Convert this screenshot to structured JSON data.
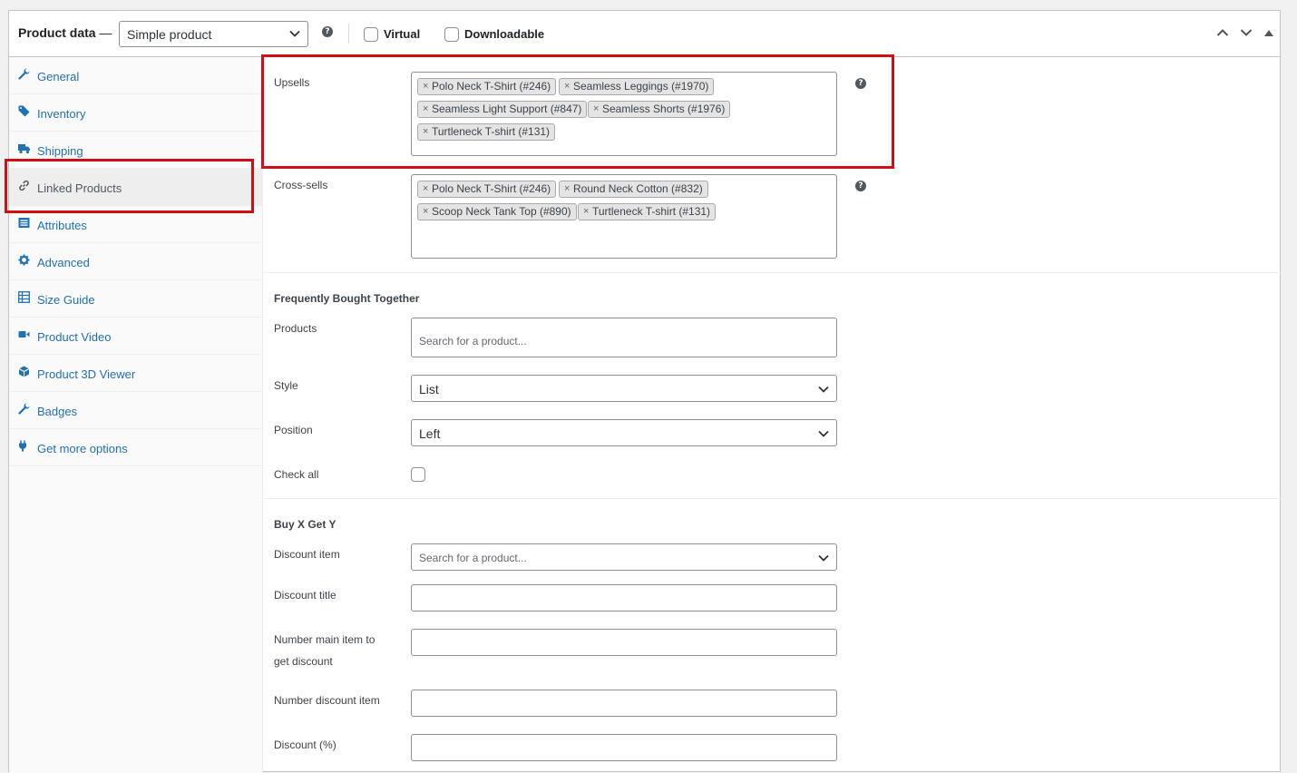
{
  "header": {
    "title": "Product data",
    "dash": "—",
    "product_type": "Simple product",
    "virtual_label": "Virtual",
    "downloadable_label": "Downloadable"
  },
  "sidebar": {
    "items": [
      {
        "label": "General",
        "icon": "wrench-icon"
      },
      {
        "label": "Inventory",
        "icon": "tag-icon"
      },
      {
        "label": "Shipping",
        "icon": "truck-icon"
      },
      {
        "label": "Linked Products",
        "icon": "link-icon",
        "active": true
      },
      {
        "label": "Attributes",
        "icon": "list-icon"
      },
      {
        "label": "Advanced",
        "icon": "gear-icon"
      },
      {
        "label": "Size Guide",
        "icon": "table-icon"
      },
      {
        "label": "Product Video",
        "icon": "video-icon"
      },
      {
        "label": "Product 3D Viewer",
        "icon": "cube-icon"
      },
      {
        "label": "Badges",
        "icon": "wrench-icon"
      },
      {
        "label": "Get more options",
        "icon": "plugin-icon"
      }
    ]
  },
  "linked": {
    "upsells_label": "Upsells",
    "upsells": [
      "Polo Neck T-Shirt (#246)",
      "Seamless Leggings (#1970)",
      "Seamless Light Support (#847)",
      "Seamless Shorts (#1976)",
      "Turtleneck T-shirt (#131)"
    ],
    "crosssells_label": "Cross-sells",
    "crosssells": [
      "Polo Neck T-Shirt (#246)",
      "Round Neck Cotton (#832)",
      "Scoop Neck Tank Top (#890)",
      "Turtleneck T-shirt (#131)"
    ]
  },
  "fbt": {
    "title": "Frequently Bought Together",
    "products_label": "Products",
    "products_placeholder": "Search for a product...",
    "style_label": "Style",
    "style_value": "List",
    "position_label": "Position",
    "position_value": "Left",
    "checkall_label": "Check all"
  },
  "bxgy": {
    "title": "Buy X Get Y",
    "discount_item_label": "Discount item",
    "discount_item_placeholder": "Search for a product...",
    "discount_title_label": "Discount title",
    "number_main_label_1": "Number main item to",
    "number_main_label_2": "get discount",
    "number_discount_label": "Number discount item",
    "discount_pct_label": "Discount (%)"
  },
  "colors": {
    "link": "#2271b1",
    "highlight": "#d10d16",
    "border": "#8c8f94"
  }
}
